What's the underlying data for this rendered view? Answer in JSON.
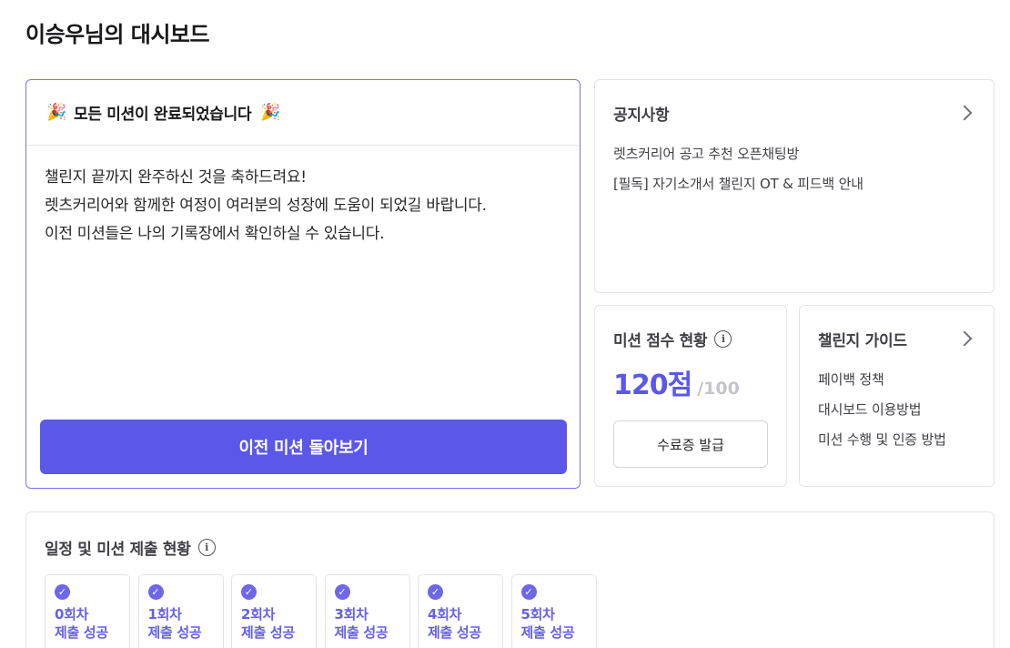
{
  "header": {
    "title": "이승우님의 대시보드"
  },
  "mission": {
    "title": "모든 미션이 완료되었습니다",
    "icon": "party-popper-icon",
    "lines": [
      "챌린지 끝까지 완주하신 것을 축하드려요!",
      "렛츠커리어와 함께한 여정이 여러분의 성장에 도움이 되었길 바랍니다.",
      "이전 미션들은 나의 기록장에서 확인하실 수 있습니다."
    ],
    "button_label": "이전 미션 돌아보기"
  },
  "notice": {
    "title": "공지사항",
    "items": [
      "렛츠커리어 공고 추천 오픈채팅방",
      "[필독] 자기소개서 챌린지 OT & 피드백 안내"
    ]
  },
  "score": {
    "title": "미션 점수 현황",
    "value": "120점",
    "max": "/100",
    "button_label": "수료증 발급"
  },
  "guide": {
    "title": "챌린지 가이드",
    "items": [
      "페이백 정책",
      "대시보드 이용방법",
      "미션 수행 및 인증 방법"
    ]
  },
  "schedule": {
    "title": "일정 및 미션 제출 현황",
    "rounds": [
      {
        "name": "0회차",
        "status": "제출 성공"
      },
      {
        "name": "1회차",
        "status": "제출 성공"
      },
      {
        "name": "2회차",
        "status": "제출 성공"
      },
      {
        "name": "3회차",
        "status": "제출 성공"
      },
      {
        "name": "4회차",
        "status": "제출 성공"
      },
      {
        "name": "5회차",
        "status": "제출 성공"
      }
    ]
  },
  "colors": {
    "accent": "#5b57e8",
    "border": "#e4e4e7",
    "muted": "#c4c4cc"
  }
}
